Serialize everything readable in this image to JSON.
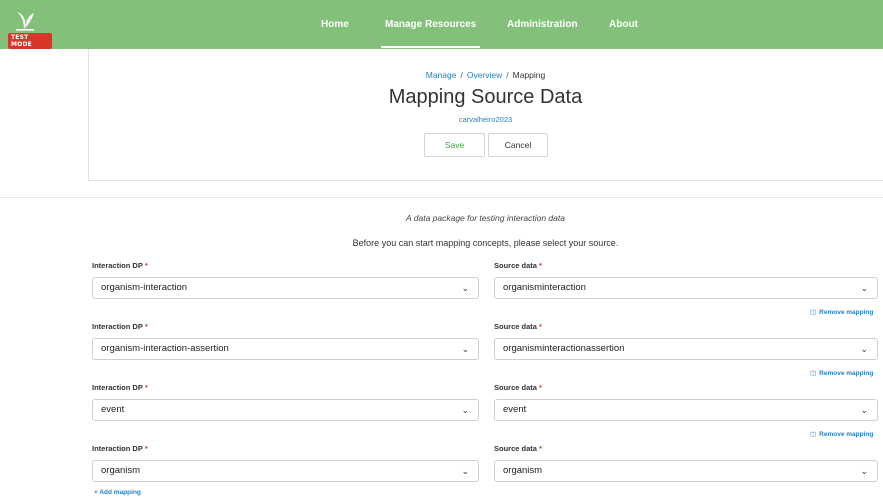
{
  "header": {
    "test_badge": "TEST MODE",
    "nav": [
      "Home",
      "Manage Resources",
      "Administration",
      "About"
    ],
    "active_nav": "Manage Resources",
    "brand_color": "#83c17a"
  },
  "breadcrumb": {
    "manage": "Manage",
    "sep": "/",
    "overview": "Overview",
    "current": "Mapping"
  },
  "page": {
    "title": "Mapping Source Data",
    "subtitle": "carvalheiro2023",
    "save_label": "Save",
    "cancel_label": "Cancel",
    "description": "A data package for testing interaction data",
    "instruction": "Before you can start mapping concepts, please select your source."
  },
  "mapping": {
    "left_label": "Interaction DP",
    "right_label": "Source data",
    "required_marker": "*",
    "remove_label": "Remove mapping",
    "add_label": "+ Add mapping",
    "rows": [
      {
        "left": "organism-interaction",
        "right": "organisminteraction"
      },
      {
        "left": "organism-interaction-assertion",
        "right": "organisminteractionassertion"
      },
      {
        "left": "event",
        "right": "event"
      },
      {
        "left": "organism",
        "right": "organism"
      }
    ]
  }
}
